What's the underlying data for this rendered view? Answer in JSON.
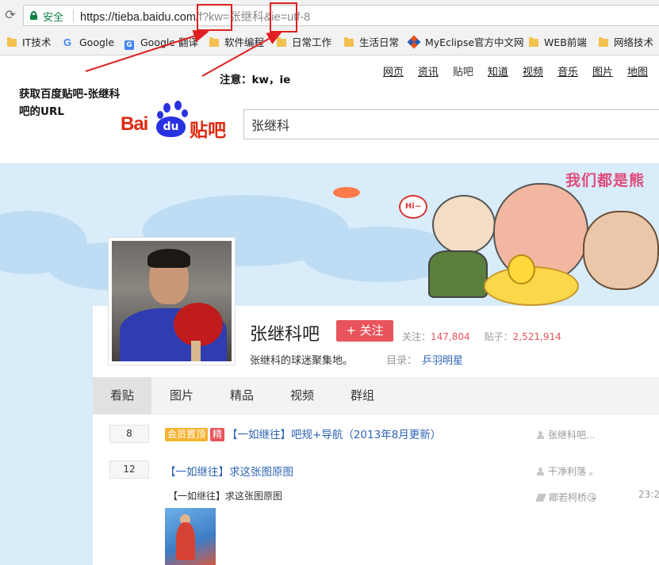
{
  "browser": {
    "secure_label": "安全",
    "url_host": "https://tieba.baidu.com",
    "url_path": "/f?kw=张继科&ie=utf-8",
    "bookmarks": [
      {
        "label": "IT技术",
        "icon": "folder-icon"
      },
      {
        "label": "Google",
        "icon": "google-icon"
      },
      {
        "label": "Google 翻译",
        "icon": "google-translate-icon"
      },
      {
        "label": "软件编程",
        "icon": "folder-icon"
      },
      {
        "label": "日常工作",
        "icon": "folder-icon"
      },
      {
        "label": "生活日常",
        "icon": "folder-icon"
      },
      {
        "label": "MyEclipse官方中文网",
        "icon": "myeclipse-icon"
      },
      {
        "label": "WEB前端",
        "icon": "folder-icon"
      },
      {
        "label": "网络技术",
        "icon": "folder-icon"
      }
    ]
  },
  "annotations": {
    "note_kw_ie": "注意：kw，ie",
    "note_url_line1": "获取百度贴吧-张继科",
    "note_url_line2": "吧的URL",
    "color": "#e02020"
  },
  "nav": {
    "items": [
      "网页",
      "资讯",
      "贴吧",
      "知道",
      "视频",
      "音乐",
      "图片",
      "地图"
    ]
  },
  "logo": {
    "bai": "Bai",
    "du": "du",
    "tieba": "贴吧"
  },
  "search": {
    "value": "张继科"
  },
  "banner": {
    "text": "我们都是熊"
  },
  "forum": {
    "name": "张继科吧",
    "follow_label": "+ 关注",
    "followers_label": "关注：",
    "followers": "147,804",
    "posts_label": "贴子：",
    "posts": "2,521,914",
    "slogan": "张继科的球迷聚集地。",
    "catalog_label": "目录：",
    "catalog_value": "乒羽明星",
    "accent": "#e9545c"
  },
  "tabs": [
    "看贴",
    "图片",
    "精品",
    "视频",
    "群组"
  ],
  "threads": [
    {
      "replies": "8",
      "tags": [
        "会员置顶",
        "精"
      ],
      "title": "【一如继往】吧规+导航（2013年8月更新）",
      "author": "张继科吧..."
    },
    {
      "replies": "12",
      "title": "【一如继往】求这张图原图",
      "desc": "【一如继往】求这张图原图",
      "author": "干净利落 ｡",
      "last_reply": "卿若柯桥😘",
      "time": "23:2"
    }
  ]
}
